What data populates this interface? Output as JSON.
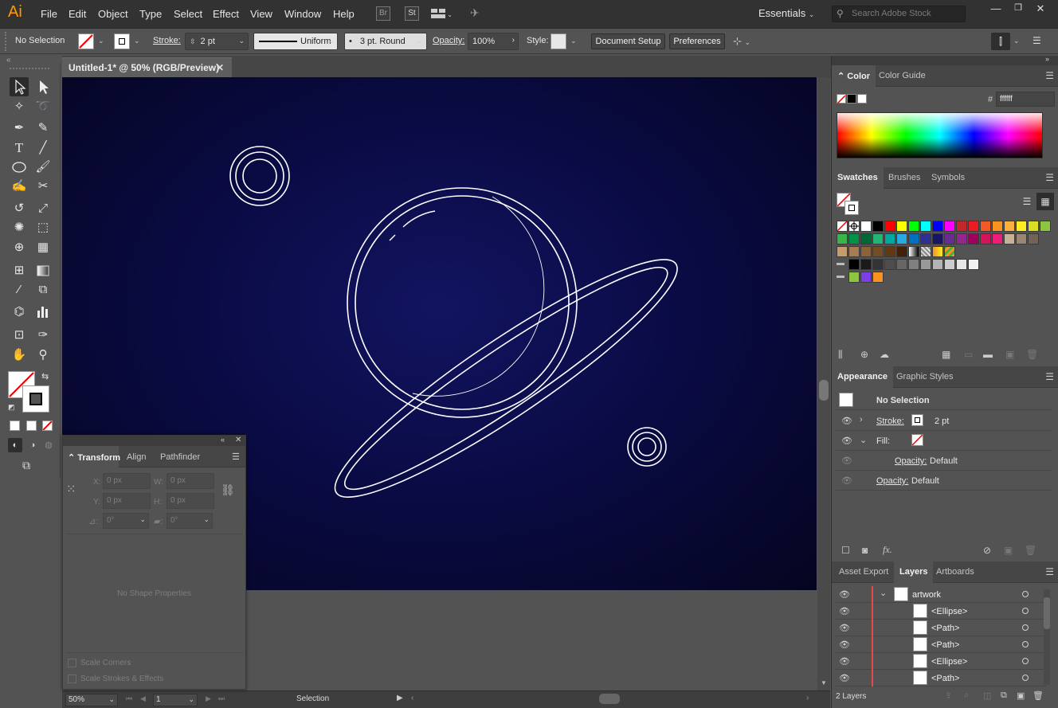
{
  "app": {
    "logo": "Ai",
    "menu": [
      "File",
      "Edit",
      "Object",
      "Type",
      "Select",
      "Effect",
      "View",
      "Window",
      "Help"
    ],
    "bridge_icon": "Br",
    "stock_icon": "St",
    "workspace": "Essentials",
    "search_placeholder": "Search Adobe Stock"
  },
  "control_bar": {
    "selection_label": "No Selection",
    "stroke_label": "Stroke:",
    "stroke_value": "2 pt",
    "profile_label": "Uniform",
    "brush_label": "3 pt. Round",
    "opacity_label": "Opacity:",
    "opacity_value": "100%",
    "style_label": "Style:",
    "document_setup": "Document Setup",
    "preferences": "Preferences"
  },
  "document": {
    "tab_title": "Untitled-1* @ 50% (RGB/Preview)",
    "artboard_color": "#0a0b45",
    "art_stroke_color": "#ffffff"
  },
  "transform_panel": {
    "tabs": [
      "Transform",
      "Align",
      "Pathfinder"
    ],
    "x_label": "X:",
    "x_value": "0 px",
    "y_label": "Y:",
    "y_value": "0 px",
    "w_label": "W:",
    "w_value": "0 px",
    "h_label": "H:",
    "h_value": "0 px",
    "angle_value": "0°",
    "shear_value": "0°",
    "empty_message": "No Shape Properties",
    "scale_corners": "Scale Corners",
    "scale_strokes": "Scale Strokes & Effects"
  },
  "status_bar": {
    "zoom": "50%",
    "artboard_num": "1",
    "tool_name": "Selection"
  },
  "color_panel": {
    "tabs": [
      "Color",
      "Color Guide"
    ],
    "hash": "#",
    "hex_value": "ffffff"
  },
  "swatches_panel": {
    "tabs": [
      "Swatches",
      "Brushes",
      "Symbols"
    ],
    "row1": [
      "#ffffff",
      "#000000",
      "#ff0000",
      "#ffff00",
      "#00ff00",
      "#00ffff",
      "#0000ff",
      "#ff00ff",
      "#c1272d",
      "#ed1c24",
      "#f15a24",
      "#f7931e",
      "#fbb03b",
      "#fcee21",
      "#d9e021",
      "#8cc63f"
    ],
    "row2": [
      "#39b54a",
      "#009245",
      "#006837",
      "#22b573",
      "#00a99d",
      "#29abe2",
      "#0071bc",
      "#2e3192",
      "#1b1464",
      "#662d91",
      "#93278f",
      "#9e005d",
      "#d4145a",
      "#ed1e79",
      "#c7b299",
      "#998675",
      "#736357"
    ],
    "row3": [
      "#c69c6d",
      "#a67c52",
      "#8c6239",
      "#754c24",
      "#603813",
      "#42210b"
    ],
    "row4": [
      "#000000",
      "#1a1a1a",
      "#333333",
      "#4d4d4d",
      "#666666",
      "#808080",
      "#999999",
      "#b3b3b3",
      "#cccccc",
      "#e6e6e6",
      "#f2f2f2"
    ],
    "row5": [
      "#8cc63f",
      "#7b3fe4",
      "#f7931e"
    ]
  },
  "appearance_panel": {
    "tabs": [
      "Appearance",
      "Graphic Styles"
    ],
    "title": "No Selection",
    "stroke_label": "Stroke:",
    "stroke_value": "2 pt",
    "fill_label": "Fill:",
    "opacity_label": "Opacity:",
    "opacity_value": "Default",
    "opacity2_label": "Opacity:",
    "opacity2_value": "Default"
  },
  "layers_panel": {
    "tabs": [
      "Asset Export",
      "Layers",
      "Artboards"
    ],
    "layer_name": "artwork",
    "items": [
      "<Ellipse>",
      "<Path>",
      "<Path>",
      "<Ellipse>",
      "<Path>"
    ],
    "footer": "2 Layers",
    "layer_color": "#e24b4b"
  }
}
